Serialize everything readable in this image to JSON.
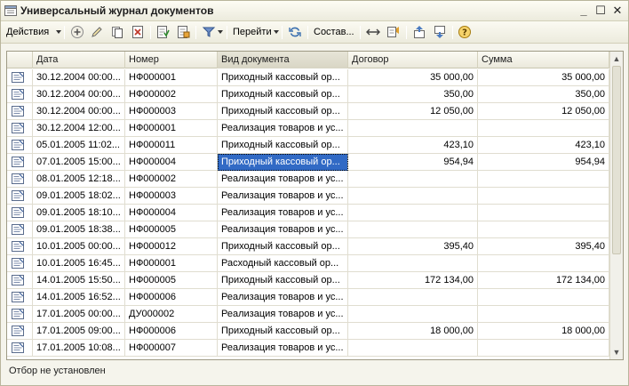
{
  "window": {
    "title": "Универсальный журнал документов",
    "min_glyph": "_",
    "max_glyph": "☐",
    "close_glyph": "✕"
  },
  "toolbar": {
    "actions_label": "Действия",
    "goto_label": "Перейти",
    "compose_label": "Состав..."
  },
  "grid": {
    "columns": [
      "Дата",
      "Номер",
      "Вид документа",
      "Договор",
      "Сумма"
    ],
    "selected_row": 5,
    "rows": [
      {
        "date": "30.12.2004 00:00...",
        "number": "НФ000001",
        "type": "Приходный кассовый ор...",
        "contract": "35 000,00",
        "sum": "35 000,00"
      },
      {
        "date": "30.12.2004 00:00...",
        "number": "НФ000002",
        "type": "Приходный кассовый ор...",
        "contract": "350,00",
        "sum": "350,00"
      },
      {
        "date": "30.12.2004 00:00...",
        "number": "НФ000003",
        "type": "Приходный кассовый ор...",
        "contract": "12 050,00",
        "sum": "12 050,00"
      },
      {
        "date": "30.12.2004 12:00...",
        "number": "НФ000001",
        "type": "Реализация товаров и ус...",
        "contract": "",
        "sum": ""
      },
      {
        "date": "05.01.2005 11:02...",
        "number": "НФ000011",
        "type": "Приходный кассовый ор...",
        "contract": "423,10",
        "sum": "423,10"
      },
      {
        "date": "07.01.2005 15:00...",
        "number": "НФ000004",
        "type": "Приходный кассовый ор...",
        "contract": "954,94",
        "sum": "954,94"
      },
      {
        "date": "08.01.2005 12:18...",
        "number": "НФ000002",
        "type": "Реализация товаров и ус...",
        "contract": "",
        "sum": ""
      },
      {
        "date": "09.01.2005 18:02...",
        "number": "НФ000003",
        "type": "Реализация товаров и ус...",
        "contract": "",
        "sum": ""
      },
      {
        "date": "09.01.2005 18:10...",
        "number": "НФ000004",
        "type": "Реализация товаров и ус...",
        "contract": "",
        "sum": ""
      },
      {
        "date": "09.01.2005 18:38...",
        "number": "НФ000005",
        "type": "Реализация товаров и ус...",
        "contract": "",
        "sum": ""
      },
      {
        "date": "10.01.2005 00:00...",
        "number": "НФ000012",
        "type": "Приходный кассовый ор...",
        "contract": "395,40",
        "sum": "395,40"
      },
      {
        "date": "10.01.2005 16:45...",
        "number": "НФ000001",
        "type": "Расходный кассовый ор...",
        "contract": "",
        "sum": ""
      },
      {
        "date": "14.01.2005 15:50...",
        "number": "НФ000005",
        "type": "Приходный кассовый ор...",
        "contract": "172 134,00",
        "sum": "172 134,00"
      },
      {
        "date": "14.01.2005 16:52...",
        "number": "НФ000006",
        "type": "Реализация товаров и ус...",
        "contract": "",
        "sum": ""
      },
      {
        "date": "17.01.2005 00:00...",
        "number": "ДУ000002",
        "type": "Реализация товаров и ус...",
        "contract": "",
        "sum": ""
      },
      {
        "date": "17.01.2005 09:00...",
        "number": "НФ000006",
        "type": "Приходный кассовый ор...",
        "contract": "18 000,00",
        "sum": "18 000,00"
      },
      {
        "date": "17.01.2005 10:08...",
        "number": "НФ000007",
        "type": "Реализация товаров и ус...",
        "contract": "",
        "sum": ""
      }
    ]
  },
  "status": {
    "filter_text": "Отбор не установлен"
  },
  "colors": {
    "selection": "#316ac5",
    "window_bg": "#f5f4ec"
  },
  "icons": [
    "journal-icon",
    "add-icon",
    "edit-icon",
    "copy-icon",
    "delete-icon",
    "post-icon",
    "unpost-icon",
    "filter-icon",
    "refresh-icon",
    "interval-icon",
    "structure-icon",
    "move-up-icon",
    "move-down-icon",
    "help-icon",
    "document-icon"
  ]
}
